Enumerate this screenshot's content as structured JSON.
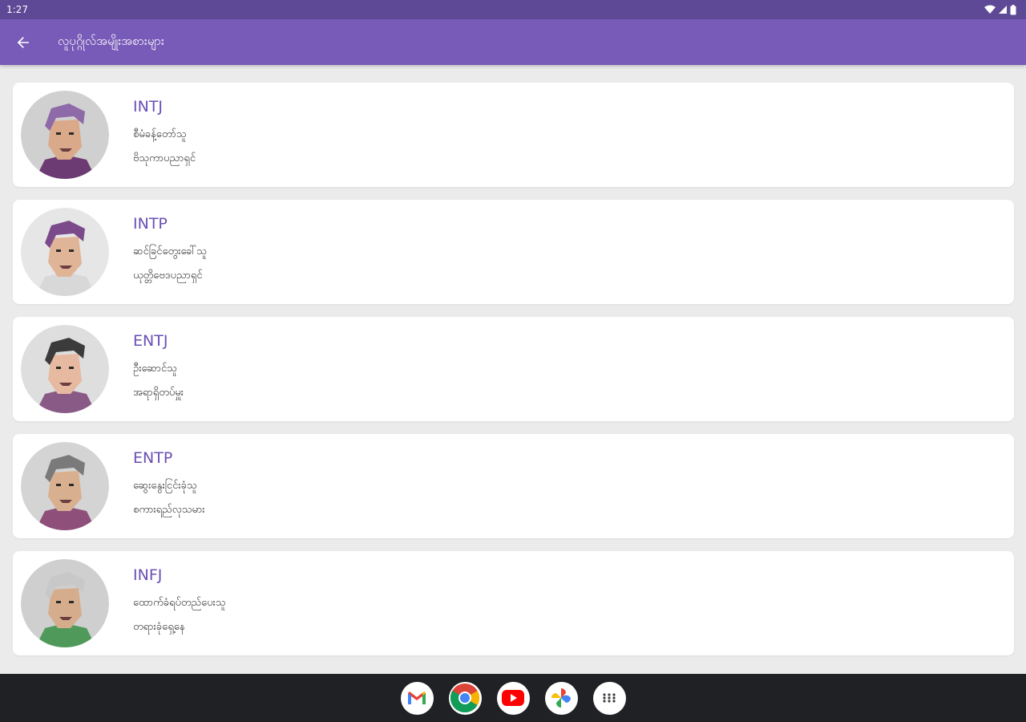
{
  "status_bar": {
    "time": "1:27"
  },
  "app_bar": {
    "title": "လူပုဂ္ဂိုလ်အမျိုးအစားများ"
  },
  "types": [
    {
      "code": "INTJ",
      "line1": "စီမံခန့်တော်သူ",
      "line2": "ဗိသုကာပညာရှင်",
      "palette": {
        "hair": "#8e6aa8",
        "skin": "#d9a98a",
        "shirt": "#6d3b73",
        "bg": "#d0d0d0"
      }
    },
    {
      "code": "INTP",
      "line1": "ဆင်ခြင်တွေးခေါ်သူ",
      "line2": "ယုတ္တိဗေဒပညာရှင်",
      "palette": {
        "hair": "#7a4a8a",
        "skin": "#e0b497",
        "shirt": "#d8d8d8",
        "bg": "#e6e6e6"
      }
    },
    {
      "code": "ENTJ",
      "line1": "ဦးဆောင်သူ",
      "line2": "အရာရှိတပ်မှူး",
      "palette": {
        "hair": "#3b3b3b",
        "skin": "#e6b9a0",
        "shirt": "#8a5a86",
        "bg": "#dedede"
      }
    },
    {
      "code": "ENTP",
      "line1": "ဆွေးနွေးငြင်းခုံသူ",
      "line2": "စကားရည်လုသမား",
      "palette": {
        "hair": "#7a7a7a",
        "skin": "#d8b08f",
        "shirt": "#8e4f7a",
        "bg": "#d4d4d4"
      }
    },
    {
      "code": "INFJ",
      "line1": "ထောက်ခံရပ်တည်ပေးသူ",
      "line2": "တရားခုံရှေ့နေ",
      "palette": {
        "hair": "#c8c8c8",
        "skin": "#d6ad8c",
        "shirt": "#4f9a5a",
        "bg": "#cfcfcf"
      }
    }
  ],
  "dock": [
    {
      "name": "gmail-app-icon"
    },
    {
      "name": "chrome-app-icon"
    },
    {
      "name": "youtube-app-icon"
    },
    {
      "name": "photos-app-icon"
    },
    {
      "name": "app-drawer-icon"
    }
  ]
}
